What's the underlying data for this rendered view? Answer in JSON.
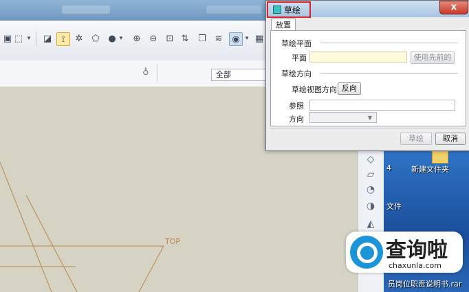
{
  "dialog": {
    "title": "草绘",
    "close_label": "x",
    "tabs": [
      {
        "label": "放置"
      }
    ],
    "sketch_plane": {
      "section_title": "草绘平面",
      "plane_label": "平面",
      "plane_value": "",
      "use_previous_button": "使用先前的"
    },
    "sketch_orientation": {
      "section_title": "草绘方向",
      "view_direction_label": "草绘视图方向",
      "flip_button": "反向",
      "reference_label": "参照",
      "reference_value": "",
      "orientation_label": "方向",
      "orientation_value": ""
    },
    "footer": {
      "sketch_button": "草绘",
      "cancel_button": "取消"
    }
  },
  "app": {
    "filter_value": "全部",
    "datum_label": "TOP"
  },
  "desktop": {
    "icons": [
      {
        "label": "新建文件夹"
      },
      {
        "label": "文件"
      },
      {
        "label": "员岗位职责说明书.rar"
      }
    ],
    "number_label": "4"
  },
  "watermark": {
    "title": "查询啦",
    "url": "chaxunla.com"
  },
  "colors": {
    "highlight": "#e02424",
    "canvas_line": "#b8874a",
    "brand": "#1b95d8"
  }
}
